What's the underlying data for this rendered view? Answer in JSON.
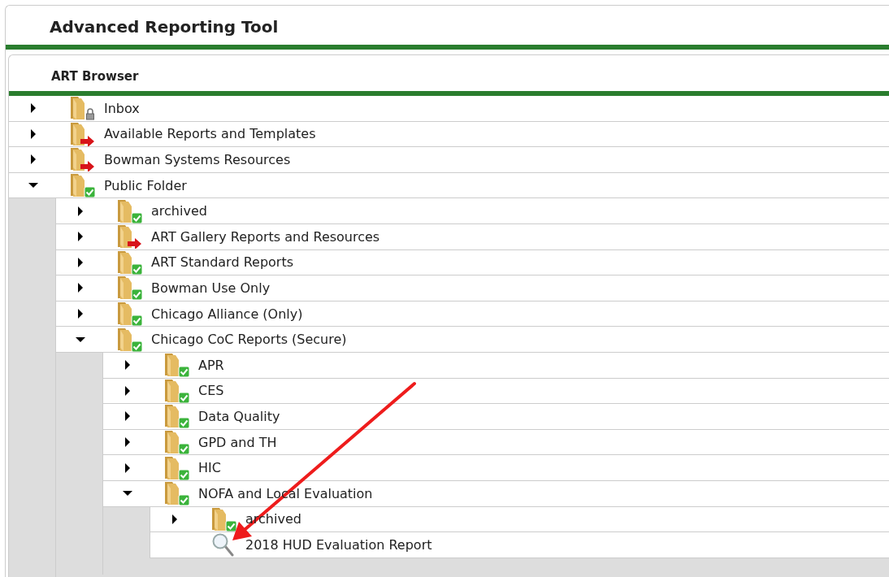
{
  "app": {
    "title": "Advanced Reporting Tool"
  },
  "browser": {
    "title": "ART Browser",
    "tree": [
      {
        "label": "Inbox",
        "kind": "folder",
        "badge": {
          "kind": "lock"
        },
        "expanded": false
      },
      {
        "label": "Available Reports and Templates",
        "kind": "folder",
        "badge": {
          "kind": "shortcut"
        },
        "expanded": false
      },
      {
        "label": "Bowman Systems Resources",
        "kind": "folder",
        "badge": {
          "kind": "shortcut"
        },
        "expanded": false
      },
      {
        "label": "Public Folder",
        "kind": "folder",
        "badge": {
          "kind": "check"
        },
        "expanded": true,
        "children": [
          {
            "label": "archived",
            "kind": "folder",
            "badge": {
              "kind": "check"
            },
            "expanded": false
          },
          {
            "label": "ART Gallery Reports and Resources",
            "kind": "folder",
            "badge": {
              "kind": "shortcut"
            },
            "expanded": false
          },
          {
            "label": "ART Standard Reports",
            "kind": "folder",
            "badge": {
              "kind": "check"
            },
            "expanded": false
          },
          {
            "label": "Bowman Use Only",
            "kind": "folder",
            "badge": {
              "kind": "check"
            },
            "expanded": false
          },
          {
            "label": "Chicago Alliance (Only)",
            "kind": "folder",
            "badge": {
              "kind": "check"
            },
            "expanded": false
          },
          {
            "label": "Chicago CoC Reports (Secure)",
            "kind": "folder",
            "badge": {
              "kind": "check"
            },
            "expanded": true,
            "children": [
              {
                "label": "APR",
                "kind": "folder",
                "badge": {
                  "kind": "check"
                },
                "expanded": false
              },
              {
                "label": "CES",
                "kind": "folder",
                "badge": {
                  "kind": "check"
                },
                "expanded": false
              },
              {
                "label": "Data Quality",
                "kind": "folder",
                "badge": {
                  "kind": "check"
                },
                "expanded": false
              },
              {
                "label": "GPD and TH",
                "kind": "folder",
                "badge": {
                  "kind": "check"
                },
                "expanded": false
              },
              {
                "label": "HIC",
                "kind": "folder",
                "badge": {
                  "kind": "check"
                },
                "expanded": false
              },
              {
                "label": "NOFA and Local Evaluation",
                "kind": "folder",
                "badge": {
                  "kind": "check"
                },
                "expanded": true,
                "children": [
                  {
                    "label": "archived",
                    "kind": "folder",
                    "badge": {
                      "kind": "check"
                    },
                    "expanded": false
                  },
                  {
                    "label": "2018 HUD Evaluation Report",
                    "kind": "report"
                  }
                ]
              }
            ]
          }
        ]
      }
    ]
  }
}
